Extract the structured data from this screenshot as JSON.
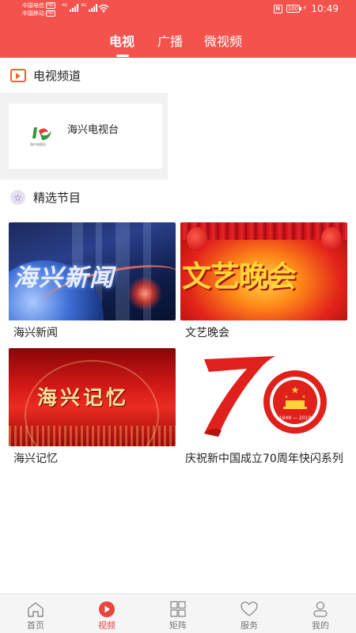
{
  "status_bar": {
    "carrier_1": "中国电信",
    "carrier_2": "中国移动",
    "hd_badge": "HD",
    "network_tag": "4G",
    "network_tag_2": "4G",
    "nfc_label": "N",
    "battery": "100",
    "time": "10:49"
  },
  "top_tabs": [
    {
      "label": "电视"
    },
    {
      "label": "广播"
    },
    {
      "label": "微视频"
    }
  ],
  "active_top_tab": "电视",
  "tv_channels": {
    "title": "电视频道",
    "items": [
      {
        "name": "海兴电视台",
        "logo_text": "海兴电视台"
      }
    ]
  },
  "featured": {
    "title": "精选节目",
    "programs": [
      {
        "label": "海兴新闻",
        "thumb_text": "海兴新闻"
      },
      {
        "label": "文艺晚会",
        "thumb_text": "文艺晚会"
      },
      {
        "label": "海兴记忆",
        "thumb_text": "海兴记忆"
      },
      {
        "label": "庆祝新中国成立70周年快闪系列",
        "thumb_text": "1949 — 2019"
      }
    ]
  },
  "bottom_nav": {
    "items": [
      {
        "label": "首页",
        "icon": "home-icon"
      },
      {
        "label": "视频",
        "icon": "video-play-icon"
      },
      {
        "label": "矩阵",
        "icon": "grid-icon"
      },
      {
        "label": "服务",
        "icon": "heart-icon"
      },
      {
        "label": "我的",
        "icon": "user-icon"
      }
    ],
    "active": "视频"
  },
  "colors": {
    "brand_red": "#f4524d",
    "nav_active": "#e8453c",
    "channel_icon": "#e8672a",
    "featured_icon": "#6a53a6"
  }
}
